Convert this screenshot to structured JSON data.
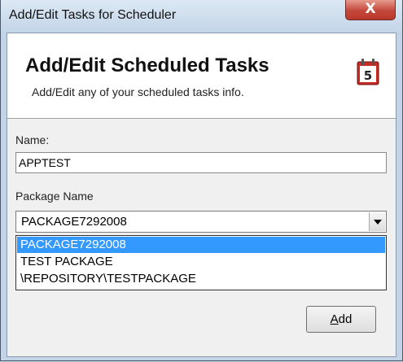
{
  "window": {
    "title": "Add/Edit Tasks for Scheduler",
    "close_glyph": "X"
  },
  "header": {
    "title": "Add/Edit Scheduled Tasks",
    "subtitle": "Add/Edit any of your scheduled tasks info.",
    "icon": "calendar-icon",
    "icon_number": "5"
  },
  "form": {
    "name_label": "Name:",
    "name_value": "APPTEST",
    "package_label": "Package Name",
    "package_selected": "PACKAGE7292008",
    "package_options": [
      "PACKAGE7292008",
      "TEST PACKAGE",
      "\\REPOSITORY\\TESTPACKAGE"
    ]
  },
  "buttons": {
    "add_label_prefix": "A",
    "add_label_rest": "dd"
  },
  "colors": {
    "selection": "#3399ff",
    "close_button": "#c4483b"
  }
}
